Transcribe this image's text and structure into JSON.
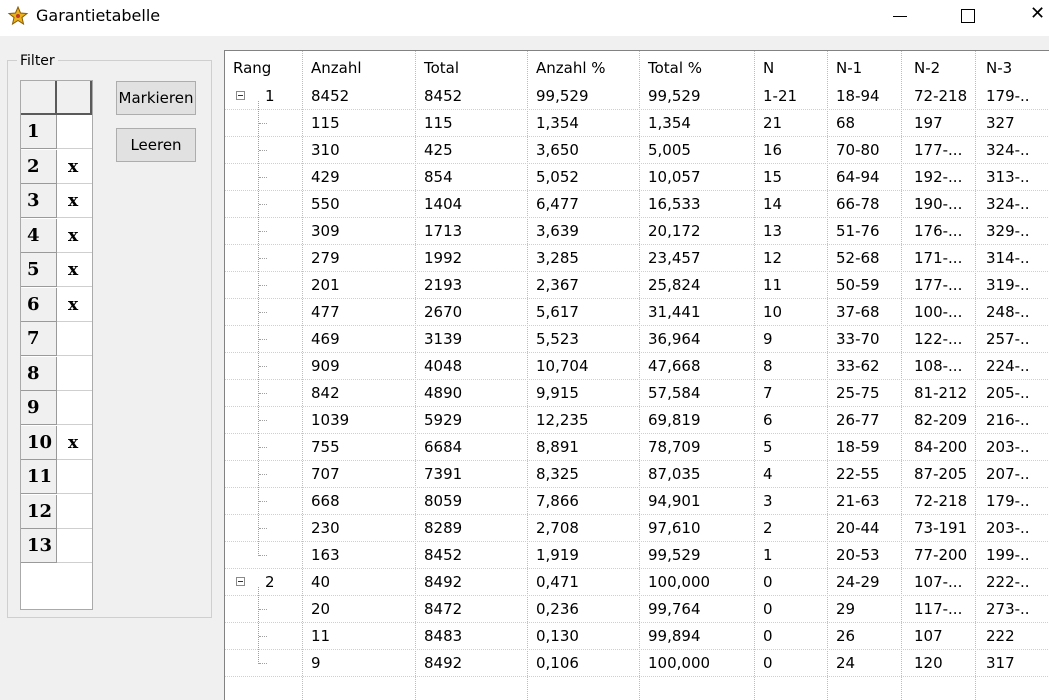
{
  "window": {
    "title": "Garantietabelle",
    "icons": {
      "app": "trophy-star-icon",
      "minimize": "minimize-icon",
      "maximize": "maximize-icon",
      "close": "close-icon"
    },
    "close_glyph": "✕"
  },
  "filter": {
    "legend": "Filter",
    "rows": [
      {
        "num": "1",
        "mark": ""
      },
      {
        "num": "2",
        "mark": "x"
      },
      {
        "num": "3",
        "mark": "x"
      },
      {
        "num": "4",
        "mark": "x"
      },
      {
        "num": "5",
        "mark": "x"
      },
      {
        "num": "6",
        "mark": "x"
      },
      {
        "num": "7",
        "mark": ""
      },
      {
        "num": "8",
        "mark": ""
      },
      {
        "num": "9",
        "mark": ""
      },
      {
        "num": "10",
        "mark": "x"
      },
      {
        "num": "11",
        "mark": ""
      },
      {
        "num": "12",
        "mark": ""
      },
      {
        "num": "13",
        "mark": ""
      }
    ],
    "buttons": {
      "mark": "Markieren",
      "clear": "Leeren"
    }
  },
  "table": {
    "columns": [
      "Rang",
      "Anzahl",
      "Total",
      "Anzahl %",
      "Total %",
      "N",
      "N-1",
      "N-2",
      "N-3"
    ],
    "groups": [
      {
        "rang": "1",
        "summary": [
          "8452",
          "8452",
          "99,529",
          "99,529",
          "1-21",
          "18-94",
          "72-218",
          "179-.."
        ],
        "children": [
          [
            "115",
            "115",
            "1,354",
            "1,354",
            "21",
            "68",
            "197",
            "327"
          ],
          [
            "310",
            "425",
            "3,650",
            "5,005",
            "16",
            "70-80",
            "177-...",
            "324-.."
          ],
          [
            "429",
            "854",
            "5,052",
            "10,057",
            "15",
            "64-94",
            "192-...",
            "313-.."
          ],
          [
            "550",
            "1404",
            "6,477",
            "16,533",
            "14",
            "66-78",
            "190-...",
            "324-.."
          ],
          [
            "309",
            "1713",
            "3,639",
            "20,172",
            "13",
            "51-76",
            "176-...",
            "329-.."
          ],
          [
            "279",
            "1992",
            "3,285",
            "23,457",
            "12",
            "52-68",
            "171-...",
            "314-.."
          ],
          [
            "201",
            "2193",
            "2,367",
            "25,824",
            "11",
            "50-59",
            "177-...",
            "319-.."
          ],
          [
            "477",
            "2670",
            "5,617",
            "31,441",
            "10",
            "37-68",
            "100-...",
            "248-.."
          ],
          [
            "469",
            "3139",
            "5,523",
            "36,964",
            "9",
            "33-70",
            "122-...",
            "257-.."
          ],
          [
            "909",
            "4048",
            "10,704",
            "47,668",
            "8",
            "33-62",
            "108-...",
            "224-.."
          ],
          [
            "842",
            "4890",
            "9,915",
            "57,584",
            "7",
            "25-75",
            "81-212",
            "205-.."
          ],
          [
            "1039",
            "5929",
            "12,235",
            "69,819",
            "6",
            "26-77",
            "82-209",
            "216-.."
          ],
          [
            "755",
            "6684",
            "8,891",
            "78,709",
            "5",
            "18-59",
            "84-200",
            "203-.."
          ],
          [
            "707",
            "7391",
            "8,325",
            "87,035",
            "4",
            "22-55",
            "87-205",
            "207-.."
          ],
          [
            "668",
            "8059",
            "7,866",
            "94,901",
            "3",
            "21-63",
            "72-218",
            "179-.."
          ],
          [
            "230",
            "8289",
            "2,708",
            "97,610",
            "2",
            "20-44",
            "73-191",
            "203-.."
          ],
          [
            "163",
            "8452",
            "1,919",
            "99,529",
            "1",
            "20-53",
            "77-200",
            "199-.."
          ]
        ]
      },
      {
        "rang": "2",
        "summary": [
          "40",
          "8492",
          "0,471",
          "100,000",
          "0",
          "24-29",
          "107-...",
          "222-.."
        ],
        "children": [
          [
            "20",
            "8472",
            "0,236",
            "99,764",
            "0",
            "29",
            "117-...",
            "273-.."
          ],
          [
            "11",
            "8483",
            "0,130",
            "99,894",
            "0",
            "26",
            "107",
            "222"
          ],
          [
            "9",
            "8492",
            "0,106",
            "100,000",
            "0",
            "24",
            "120",
            "317"
          ]
        ]
      }
    ]
  }
}
